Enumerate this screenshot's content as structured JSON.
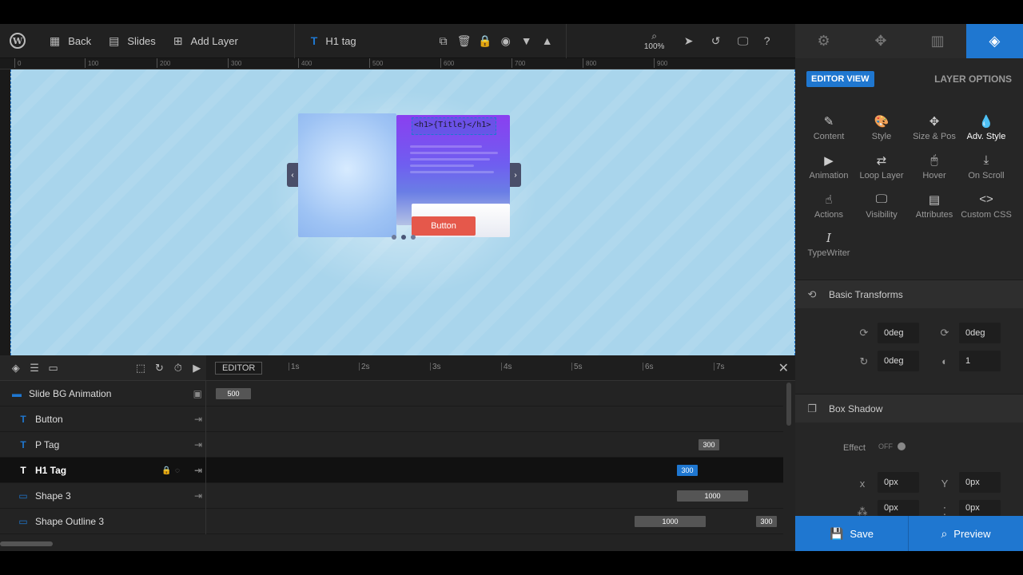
{
  "toolbar": {
    "back_label": "Back",
    "slides_label": "Slides",
    "add_layer_label": "Add Layer",
    "current_layer_label": "H1 tag",
    "zoom": "100%"
  },
  "ruler": {
    "ticks": [
      "0",
      "100",
      "200",
      "300",
      "400",
      "500",
      "600",
      "700",
      "800",
      "900"
    ]
  },
  "canvas": {
    "h1_text": "<h1>{Title}</h1>",
    "button_text": "Button"
  },
  "timeline": {
    "editor_label": "EDITOR",
    "seconds": [
      "1s",
      "2s",
      "3s",
      "4s",
      "5s",
      "6s",
      "7s"
    ],
    "layers": [
      {
        "name": "Slide BG Animation",
        "bars": [
          "500"
        ]
      },
      {
        "name": "Button",
        "bars": []
      },
      {
        "name": "P Tag",
        "bars": [
          "300"
        ]
      },
      {
        "name": "H1 Tag",
        "bars": [
          "300"
        ]
      },
      {
        "name": "Shape 3",
        "bars": [
          "1000"
        ]
      },
      {
        "name": "Shape Outline 3",
        "bars": [
          "1000",
          "300"
        ]
      }
    ]
  },
  "panel": {
    "editor_view": "EDITOR VIEW",
    "layer_options": "LAYER OPTIONS",
    "options": [
      "Content",
      "Style",
      "Size & Pos",
      "Adv. Style",
      "Animation",
      "Loop Layer",
      "Hover",
      "On Scroll",
      "Actions",
      "Visibility",
      "Attributes",
      "Custom CSS",
      "TypeWriter"
    ],
    "basic_transforms": "Basic Transforms",
    "rotate_x": "0deg",
    "rotate_y": "0deg",
    "rotate_z": "0deg",
    "opacity": "1",
    "box_shadow": "Box Shadow",
    "effect_label": "Effect",
    "effect_value": "OFF",
    "shadow_x": "0px",
    "shadow_y": "0px",
    "shadow_blur": "0px",
    "shadow_spread": "0px"
  },
  "footer": {
    "save_label": "Save",
    "preview_label": "Preview"
  },
  "colors": {
    "accent": "#1f77d0",
    "button": "#e5584b",
    "canvas_bg": "#a9d5ec"
  }
}
